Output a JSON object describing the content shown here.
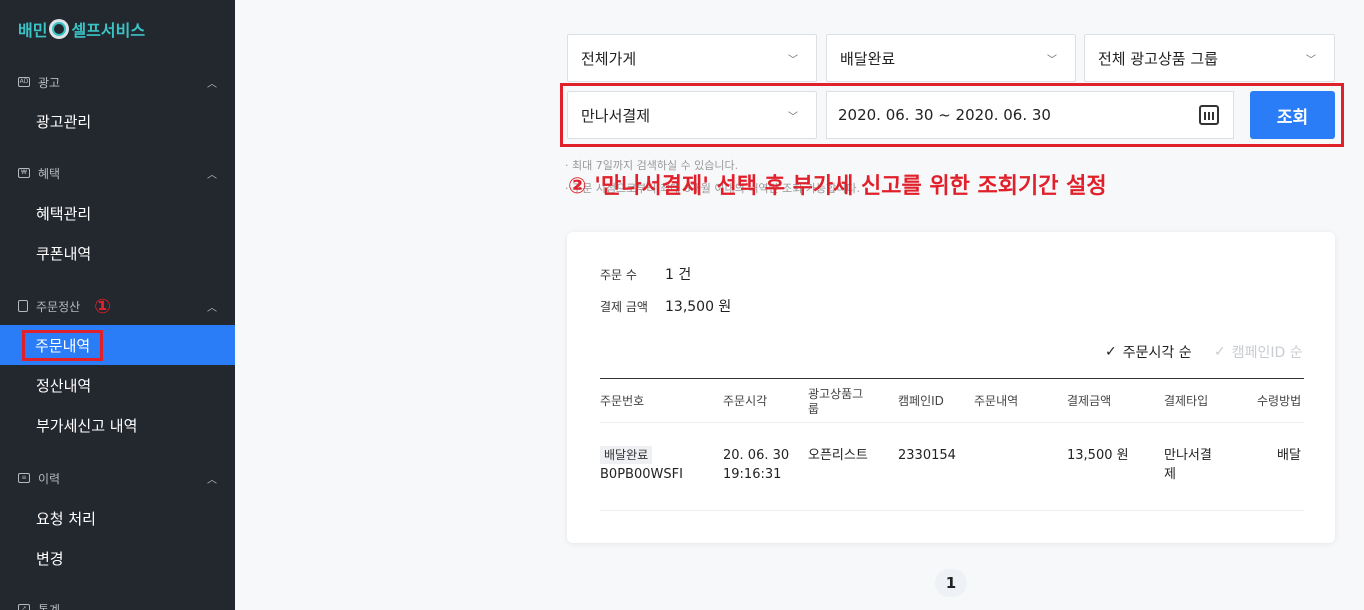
{
  "sidebar": {
    "brand": {
      "left": "배민",
      "right": "셀프서비스"
    },
    "sections": [
      {
        "label": "광고",
        "icon": "ad-icon",
        "items": [
          "광고관리"
        ]
      },
      {
        "label": "혜택",
        "icon": "coupon-icon",
        "items": [
          "혜택관리",
          "쿠폰내역"
        ]
      },
      {
        "label": "주문정산",
        "icon": "receipt-icon",
        "marker": "①",
        "items": [
          "주문내역",
          "정산내역",
          "부가세신고 내역"
        ]
      },
      {
        "label": "이력",
        "icon": "history-icon",
        "items": [
          "요청 처리",
          "변경"
        ]
      },
      {
        "label": "통계",
        "icon": "chart-icon"
      }
    ],
    "active_item": "주문내역"
  },
  "filters": {
    "store": "전체가게",
    "status": "배달완료",
    "ad_group": "전체 광고상품 그룹",
    "payment": "만나서결제",
    "date_range": "2020. 06. 30 ~ 2020. 06. 30",
    "search_button": "조회",
    "hint1": "· 최대 7일까지 검색하실 수 있습니다.",
    "hint2": "· 주문 시점으로부터 최대 6개월 이내의 내역만 조회 가능합니다."
  },
  "annotation": "② '만나서결제' 선택 후 부가세 신고를 위한 조회기간 설정",
  "summary": {
    "order_count_label": "주문 수",
    "order_count_value": "1 건",
    "amount_label": "결제 금액",
    "amount_value": "13,500 원"
  },
  "sort": {
    "by_time": "주문시각 순",
    "by_campaign": "캠페인ID 순"
  },
  "table": {
    "headers": [
      "주문번호",
      "주문시각",
      "광고상품그룹",
      "캠페인ID",
      "주문내역",
      "결제금액",
      "결제타입",
      "수령방법"
    ],
    "rows": [
      {
        "status": "배달완료",
        "order_no": "B0PB00WSFI",
        "date": "20. 06. 30",
        "time": "19:16:31",
        "ad_group": "오픈리스트",
        "campaign_id": "2330154",
        "order_detail": "",
        "amount": "13,500 원",
        "pay_type": "만나서결제",
        "delivery": "배달"
      }
    ]
  },
  "pagination": {
    "current": "1"
  },
  "colors": {
    "accent": "#2a7df6",
    "annotation_red": "#e0202a",
    "sidebar_bg": "#23272e",
    "brand_teal": "#39c3c5"
  }
}
